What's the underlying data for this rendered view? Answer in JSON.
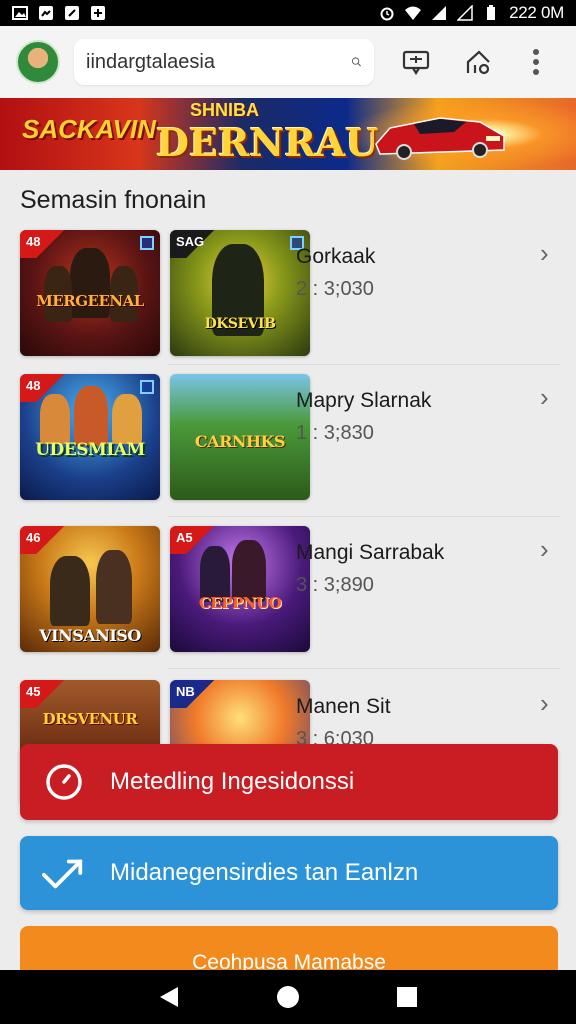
{
  "status_bar": {
    "time": "222 0M"
  },
  "search": {
    "value": "iindargtalaesia"
  },
  "banner": {
    "left_text": "SACKAVIN",
    "center_top": "SHNIBA",
    "center_text": "DERNRAU"
  },
  "section": {
    "title": "Semasin fnonain"
  },
  "items": [
    {
      "name": "Gorkaak",
      "meta": "2 : 3;030",
      "thumbs": [
        {
          "badge": "48",
          "title": "MERGEENAL",
          "palette": "#5a1414"
        },
        {
          "badge": "SAG",
          "title": "DKSEVIB",
          "palette": "#3a3a12"
        }
      ]
    },
    {
      "name": "Mapry Slarnak",
      "meta": "1 : 3;830",
      "thumbs": [
        {
          "badge": "48",
          "title": "UDESMIAM",
          "palette": "#1b3f8a"
        },
        {
          "badge": "",
          "title": "CARNHKS",
          "palette": "#2d5a1a"
        }
      ]
    },
    {
      "name": "Mangi Sarrabak",
      "meta": "3 : 3;890",
      "thumbs": [
        {
          "badge": "46",
          "title": "VINSANISO",
          "palette": "#8a4a10"
        },
        {
          "badge": "A5",
          "title": "CEPPNUO",
          "palette": "#4a1a7a"
        }
      ]
    },
    {
      "name": "Manen Sit",
      "meta": "3 : 6;030",
      "thumbs": [
        {
          "badge": "45",
          "title": "DRSVENUR",
          "palette": "#6a2a12"
        },
        {
          "badge": "NB",
          "title": "",
          "palette": "#c85a1e"
        }
      ]
    }
  ],
  "buttons": {
    "primary_red": "Metedling Ingesidonssi",
    "secondary_blue": "Midanegensirdies tan Eanlzn",
    "tertiary_orange": "Ceohpusa Mamabse"
  },
  "colors": {
    "red": "#c81d22",
    "blue": "#2d93d8",
    "orange": "#f28a1e",
    "badge_red": "#d51818"
  }
}
